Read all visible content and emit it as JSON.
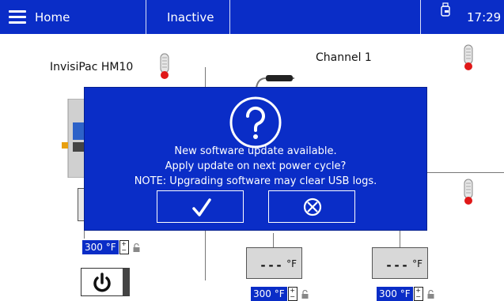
{
  "topbar": {
    "home_label": "Home",
    "status_label": "Inactive",
    "time": "17:29",
    "usb_icon": "usb-drive-icon"
  },
  "device": {
    "name": "InvisiPac HM10",
    "setpoint": "300 °F"
  },
  "channel": {
    "title": "Channel 1",
    "hose": {
      "temp_display": "---",
      "temp_unit": "°F",
      "setpoint": "300 °F"
    },
    "applicator": {
      "temp_display": "---",
      "temp_unit": "°F",
      "setpoint": "300 °F"
    }
  },
  "dialog": {
    "icon": "question-circle-icon",
    "line1": "New software update available.",
    "line2": "Apply update on next power cycle?",
    "line3": "NOTE: Upgrading software may clear USB logs.",
    "accept_icon": "checkmark-icon",
    "cancel_icon": "cancel-circle-x-icon"
  },
  "colors": {
    "brand_blue": "#0a2dc7",
    "thermo_red": "#e01818"
  }
}
